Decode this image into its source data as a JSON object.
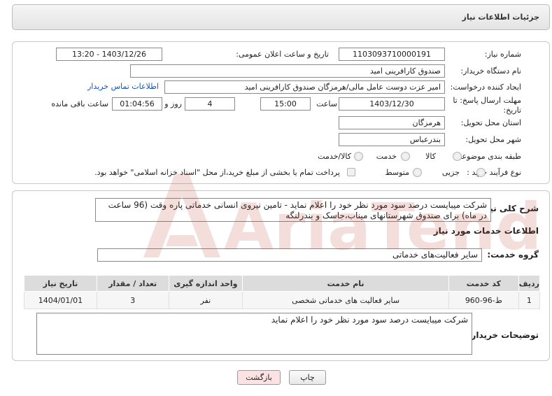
{
  "header": {
    "title": "جزئیات اطلاعات نیاز"
  },
  "form": {
    "need_number": {
      "label": "شماره نیاز:",
      "value": "1103093710000191"
    },
    "announce_datetime": {
      "label": "تاریخ و ساعت اعلان عمومی:",
      "value": "1403/12/26 - 13:20"
    },
    "buyer_org": {
      "label": "نام دستگاه خریدار:",
      "value": "صندوق کارافرینی امید"
    },
    "requester": {
      "label": "ایجاد کننده درخواست:",
      "value": "امیر عزت دوست عامل مالی/هرمزگان صندوق کارافرینی امید",
      "contact_link": "اطلاعات تماس خریدار"
    },
    "deadline": {
      "label_line1": "مهلت ارسال پاسخ: تا",
      "label_line2": "تاریخ:",
      "date": "1403/12/30",
      "time_label": "ساعت",
      "time": "15:00",
      "days": "4",
      "days_label": "روز و",
      "remaining": "01:04:56",
      "remaining_label": "ساعت باقی مانده"
    },
    "province": {
      "label": "استان محل تحویل:",
      "value": "هرمزگان"
    },
    "city": {
      "label": "شهر محل تحویل:",
      "value": "بندرعباس"
    },
    "category": {
      "label": "طبقه بندی موضوعی:",
      "options": [
        "کالا",
        "خدمت",
        "کالا/خدمت"
      ]
    },
    "purchase_type": {
      "label": "نوع فرآیند خرید :",
      "options": [
        "جزیی",
        "متوسط"
      ],
      "payment_note": "پرداخت تمام یا بخشی از مبلغ خرید،از محل \"اسناد خزانه اسلامی\" خواهد بود."
    }
  },
  "description": {
    "label": "شرح کلی نیاز:",
    "text": "شرکت میبایست درصد سود مورد نظر خود را اعلام نماید - تامین نیروی انسانی خدماتی پاره وقت (96 ساعت در ماه) برای صندوق شهرستانهای میناب،جاسک و بندرلنگه"
  },
  "services": {
    "section_title": "اطلاعات خدمات مورد نیاز",
    "group_label": "گروه خدمت:",
    "group_value": "سایر فعالیت‌های خدماتی",
    "columns": [
      "ردیف",
      "کد خدمت",
      "نام خدمت",
      "واحد اندازه گیری",
      "تعداد / مقدار",
      "تاریخ نیاز"
    ],
    "rows": [
      [
        "1",
        "ط-96-960",
        "سایر فعالیت های خدماتی شخصی",
        "نفر",
        "3",
        "1404/01/01"
      ]
    ]
  },
  "buyer_notes": {
    "label": "توضیحات خریدار:",
    "text": "شرکت میبایست درصد سود مورد نظر خود را اعلام نماید"
  },
  "buttons": {
    "print": "چاپ",
    "back": "بازگشت"
  },
  "watermark": {
    "text": "AriaTender.neT"
  },
  "colors": {
    "link": "#1a52b8",
    "back_button_bg": "#fbe3e3",
    "header_bg": "#e9e9e9",
    "watermark": "#c0392b"
  }
}
